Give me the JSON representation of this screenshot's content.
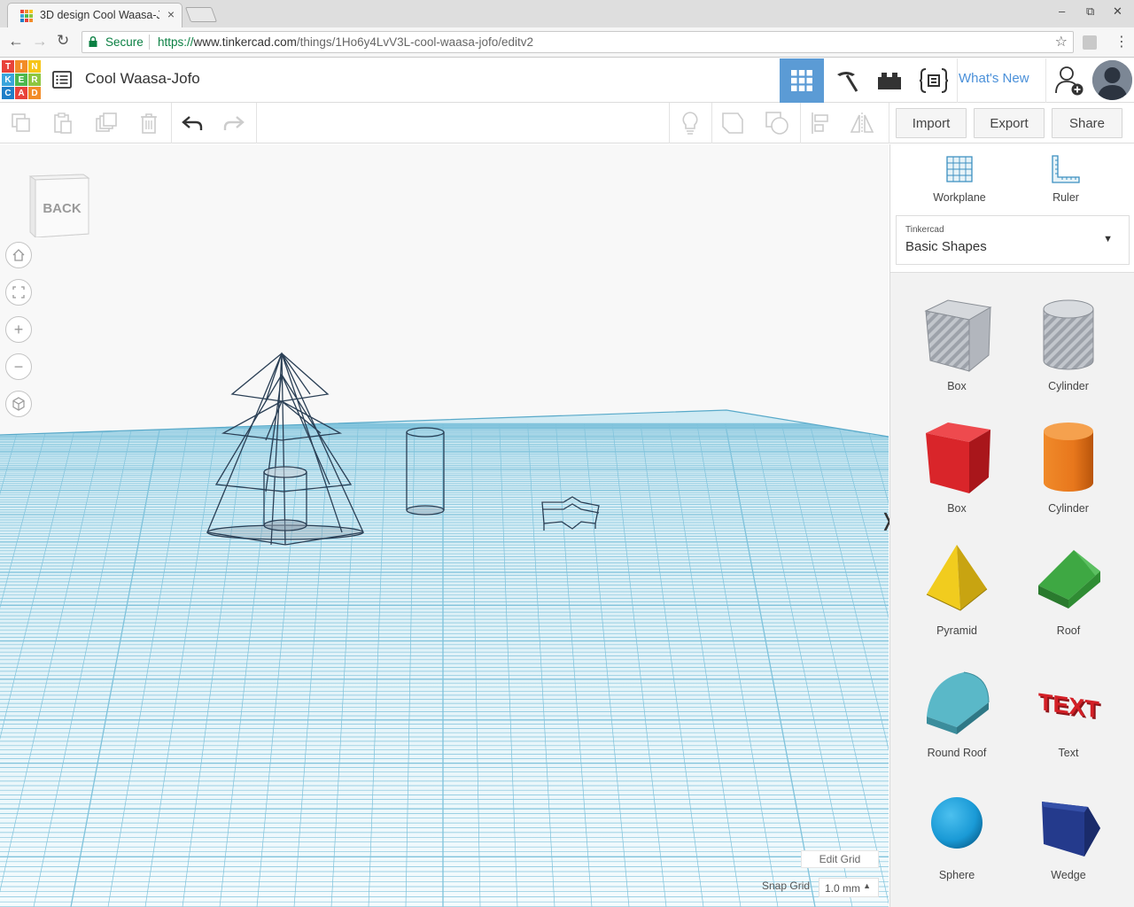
{
  "browser": {
    "tab_title": "3D design Cool Waasa-J",
    "tab_close": "×",
    "secure_label": "Secure",
    "url_scheme": "https://",
    "url_host": "www.tinkercad.com",
    "url_path": "/things/1Ho6y4LvV3L-cool-waasa-jofo/editv2"
  },
  "app": {
    "logo_letters": [
      "T",
      "I",
      "N",
      "K",
      "E",
      "R",
      "C",
      "A",
      "D"
    ],
    "logo_colors": [
      "#e8423a",
      "#f28c28",
      "#f6c517",
      "#3aa5dc",
      "#4cb84e",
      "#8dc63f",
      "#1e7ec8",
      "#e8423a",
      "#f28c28"
    ],
    "design_title": "Cool Waasa-Jofo",
    "whats_new": "What's New",
    "accent": "#5b9bd5"
  },
  "toolbar": {
    "import": "Import",
    "export": "Export",
    "share": "Share"
  },
  "viewport": {
    "viewcube_label": "BACK",
    "edit_grid": "Edit Grid",
    "snap_grid_label": "Snap Grid",
    "snap_grid_value": "1.0 mm",
    "snap_caret": "▲",
    "collapse_glyph": "❭",
    "zoom_in": "+",
    "zoom_out": "−"
  },
  "panel": {
    "workplane": "Workplane",
    "ruler": "Ruler",
    "library_vendor": "Tinkercad",
    "library_name": "Basic Shapes",
    "shapes": [
      {
        "label": "Box",
        "icon": "box-hole-icon"
      },
      {
        "label": "Cylinder",
        "icon": "cylinder-hole-icon"
      },
      {
        "label": "Box",
        "icon": "box-icon",
        "color": "#d9252a"
      },
      {
        "label": "Cylinder",
        "icon": "cylinder-icon",
        "color": "#e8771c"
      },
      {
        "label": "Pyramid",
        "icon": "pyramid-icon",
        "color": "#f1cc1e"
      },
      {
        "label": "Roof",
        "icon": "roof-icon",
        "color": "#3ea843"
      },
      {
        "label": "Round Roof",
        "icon": "round-roof-icon",
        "color": "#5ab8c8"
      },
      {
        "label": "Text",
        "icon": "text-icon",
        "color": "#d42027"
      },
      {
        "label": "Sphere",
        "icon": "sphere-icon",
        "color": "#1a9ad6"
      },
      {
        "label": "Wedge",
        "icon": "wedge-icon",
        "color": "#243a8c"
      }
    ]
  }
}
